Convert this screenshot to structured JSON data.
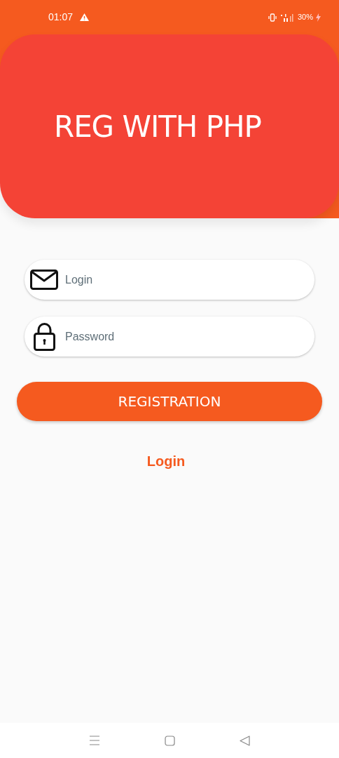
{
  "status_bar": {
    "time": "01:07",
    "battery": "30%"
  },
  "header": {
    "title": "REG WITH PHP"
  },
  "fields": [
    {
      "kind": "email",
      "placeholder": "Login"
    },
    {
      "kind": "password",
      "placeholder": "Password"
    }
  ],
  "primary_button": "REGISTRATION",
  "link": "Login"
}
